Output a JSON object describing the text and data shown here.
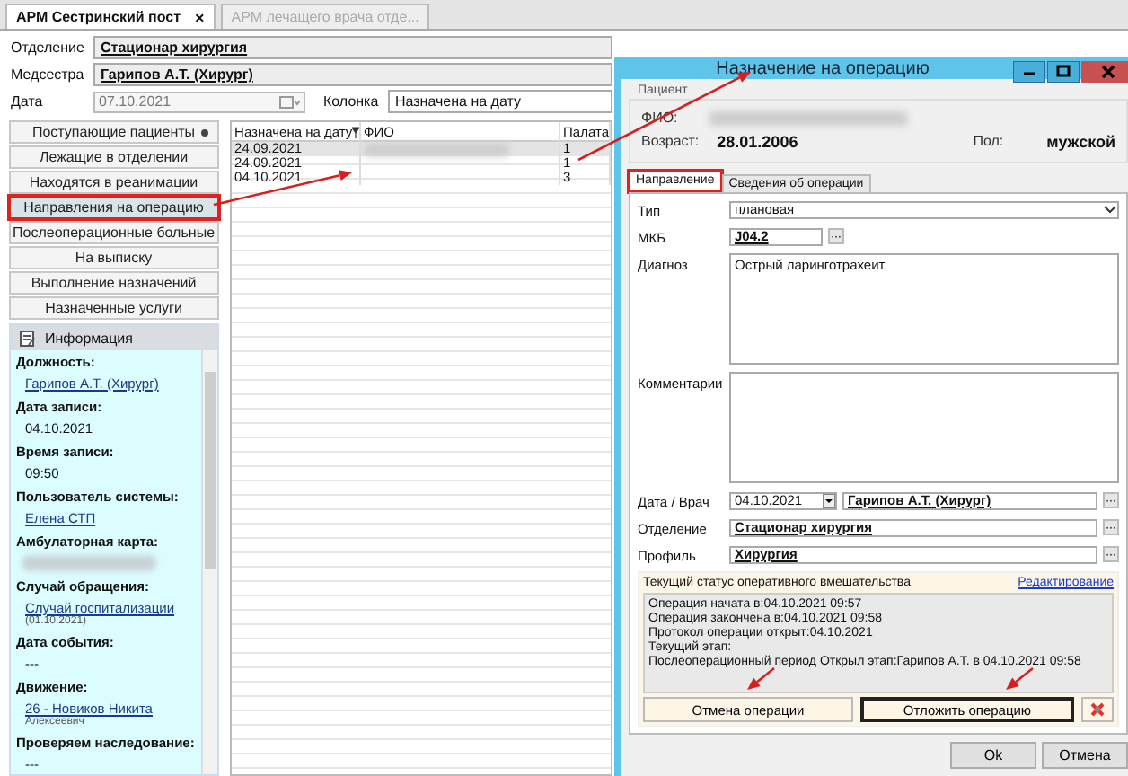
{
  "tabs": [
    {
      "label": "АРМ Сестринский пост",
      "selected": true,
      "close": "×"
    },
    {
      "label": "АРМ лечащего врача отде...",
      "selected": false
    }
  ],
  "header": {
    "department": {
      "label": "Отделение",
      "value": "Стационар хирургия"
    },
    "nurse": {
      "label": "Медсестра",
      "value": "Гарипов А.Т. (Хирург)"
    },
    "date": {
      "label": "Дата",
      "value": "07.10.2021",
      "disabled": true
    },
    "column": {
      "label": "Колонка",
      "value": "Назначена на дату"
    }
  },
  "nav": [
    {
      "label": "Поступающие пациенты",
      "selected": false,
      "highlighted": false,
      "indicator": true
    },
    {
      "label": "Лежащие в отделении",
      "selected": false,
      "highlighted": false,
      "indicator": false
    },
    {
      "label": "Находятся в реанимации",
      "selected": false,
      "highlighted": false,
      "indicator": false
    },
    {
      "label": "Направления на операцию",
      "selected": true,
      "highlighted": true,
      "indicator": false
    },
    {
      "label": "Послеоперационные больные",
      "selected": false,
      "highlighted": false,
      "indicator": false
    },
    {
      "label": "На выписку",
      "selected": false,
      "highlighted": false,
      "indicator": false
    },
    {
      "label": "Выполнение назначений",
      "selected": false,
      "highlighted": false,
      "indicator": false
    },
    {
      "label": "Назначенные услуги",
      "selected": false,
      "highlighted": false,
      "indicator": false
    }
  ],
  "grid": {
    "columns": [
      "Назначена на дату",
      "ФИО",
      "Палата"
    ],
    "rows": [
      {
        "date": "24.09.2021",
        "ward": "1",
        "selected": true
      },
      {
        "date": "24.09.2021",
        "ward": "1",
        "selected": false
      },
      {
        "date": "04.10.2021",
        "ward": "3",
        "selected": false
      }
    ]
  },
  "info": {
    "title": "Информация",
    "items": [
      {
        "label": "Должность:",
        "kind": "link",
        "value": "Гарипов А.Т. (Хирург)"
      },
      {
        "label": "Дата записи:",
        "kind": "text",
        "value": "04.10.2021"
      },
      {
        "label": "Время записи:",
        "kind": "text",
        "value": "09:50"
      },
      {
        "label": "Пользователь системы:",
        "kind": "link",
        "value": "Елена СТП"
      },
      {
        "label": "Амбулаторная карта:",
        "kind": "blurred"
      },
      {
        "label": "Случай обращения:",
        "kind": "link",
        "value": "Случай госпитализации",
        "note": "(01.10.2021)"
      },
      {
        "label": "Дата события:",
        "kind": "text",
        "value": "---"
      },
      {
        "label": "Движение:",
        "kind": "link",
        "value": "26 - Новиков Никита",
        "note": "Алексеевич"
      },
      {
        "label": "Проверяем наследование:",
        "kind": "text",
        "value": "---"
      }
    ]
  },
  "dialog": {
    "title": "Назначение на операцию",
    "patient": {
      "group_label": "Пациент",
      "fio_label": "ФИО:",
      "age_label": "Возраст:",
      "age_value": "28.01.2006",
      "sex_label": "Пол:",
      "sex_value": "мужской"
    },
    "tabs": [
      {
        "label": "Направление",
        "selected": true,
        "highlighted": true
      },
      {
        "label": "Сведения об операции",
        "selected": false,
        "highlighted": false
      }
    ],
    "type": {
      "label": "Тип",
      "value": "плановая"
    },
    "mkb": {
      "label": "МКБ",
      "value": "J04.2"
    },
    "diagnosis": {
      "label": "Диагноз",
      "value": "Острый ларинготрахеит"
    },
    "comments": {
      "label": "Комментарии"
    },
    "date_doctor": {
      "label": "Дата / Врач",
      "date": "04.10.2021",
      "doctor": "Гарипов А.Т. (Хирург)"
    },
    "department": {
      "label": "Отделение",
      "value": "Стационар хирургия"
    },
    "profile": {
      "label": "Профиль",
      "value": "Хирургия"
    },
    "status": {
      "title": "Текущий статус оперативного вмешательства",
      "edit_link": "Редактирование",
      "lines": [
        "Операция начата в:04.10.2021 09:57",
        "Операция закончена в:04.10.2021 09:58",
        "Протокол операции открыт:04.10.2021",
        "Текущий этап:",
        "Послеоперационный период Открыл этап:Гарипов А.Т. в 04.10.2021 09:58"
      ]
    },
    "actions": [
      {
        "kind": "text",
        "label": "Отмена операции",
        "focused": false
      },
      {
        "kind": "text",
        "label": "Отложить операцию",
        "focused": true
      },
      {
        "kind": "icon",
        "focused": false
      }
    ],
    "buttons": [
      "Ok",
      "Отмена"
    ]
  }
}
